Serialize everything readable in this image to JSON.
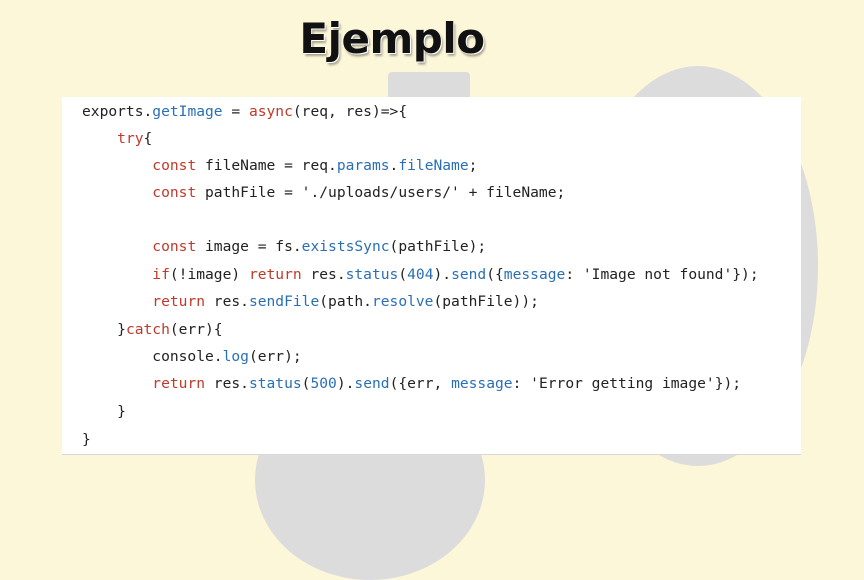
{
  "title": "Ejemplo",
  "code": {
    "lines": [
      [
        {
          "t": "exports.",
          "c": "plain"
        },
        {
          "t": "getImage",
          "c": "fn"
        },
        {
          "t": " = ",
          "c": "plain"
        },
        {
          "t": "async",
          "c": "kw"
        },
        {
          "t": "(req, res)=>{",
          "c": "plain"
        }
      ],
      [
        {
          "t": "    ",
          "c": "plain"
        },
        {
          "t": "try",
          "c": "kw"
        },
        {
          "t": "{",
          "c": "plain"
        }
      ],
      [
        {
          "t": "        ",
          "c": "plain"
        },
        {
          "t": "const",
          "c": "kw"
        },
        {
          "t": " fileName = req.",
          "c": "plain"
        },
        {
          "t": "params",
          "c": "prop"
        },
        {
          "t": ".",
          "c": "plain"
        },
        {
          "t": "fileName",
          "c": "prop"
        },
        {
          "t": ";",
          "c": "plain"
        }
      ],
      [
        {
          "t": "        ",
          "c": "plain"
        },
        {
          "t": "const",
          "c": "kw"
        },
        {
          "t": " pathFile = ",
          "c": "plain"
        },
        {
          "t": "'./uploads/users/'",
          "c": "str"
        },
        {
          "t": " + fileName;",
          "c": "plain"
        }
      ],
      [],
      [
        {
          "t": "        ",
          "c": "plain"
        },
        {
          "t": "const",
          "c": "kw"
        },
        {
          "t": " image = fs.",
          "c": "plain"
        },
        {
          "t": "existsSync",
          "c": "fn"
        },
        {
          "t": "(pathFile);",
          "c": "plain"
        }
      ],
      [
        {
          "t": "        ",
          "c": "plain"
        },
        {
          "t": "if",
          "c": "kw"
        },
        {
          "t": "(!image) ",
          "c": "plain"
        },
        {
          "t": "return",
          "c": "kw"
        },
        {
          "t": " res.",
          "c": "plain"
        },
        {
          "t": "status",
          "c": "fn"
        },
        {
          "t": "(",
          "c": "plain"
        },
        {
          "t": "404",
          "c": "num"
        },
        {
          "t": ").",
          "c": "plain"
        },
        {
          "t": "send",
          "c": "fn"
        },
        {
          "t": "({",
          "c": "plain"
        },
        {
          "t": "message",
          "c": "prop"
        },
        {
          "t": ": ",
          "c": "plain"
        },
        {
          "t": "'Image not found'",
          "c": "str"
        },
        {
          "t": "});",
          "c": "plain"
        }
      ],
      [
        {
          "t": "        ",
          "c": "plain"
        },
        {
          "t": "return",
          "c": "kw"
        },
        {
          "t": " res.",
          "c": "plain"
        },
        {
          "t": "sendFile",
          "c": "fn"
        },
        {
          "t": "(path.",
          "c": "plain"
        },
        {
          "t": "resolve",
          "c": "fn"
        },
        {
          "t": "(pathFile));",
          "c": "plain"
        }
      ],
      [
        {
          "t": "    }",
          "c": "plain"
        },
        {
          "t": "catch",
          "c": "kw"
        },
        {
          "t": "(err){",
          "c": "plain"
        }
      ],
      [
        {
          "t": "        console.",
          "c": "plain"
        },
        {
          "t": "log",
          "c": "fn"
        },
        {
          "t": "(err);",
          "c": "plain"
        }
      ],
      [
        {
          "t": "        ",
          "c": "plain"
        },
        {
          "t": "return",
          "c": "kw"
        },
        {
          "t": " res.",
          "c": "plain"
        },
        {
          "t": "status",
          "c": "fn"
        },
        {
          "t": "(",
          "c": "plain"
        },
        {
          "t": "500",
          "c": "num"
        },
        {
          "t": ").",
          "c": "plain"
        },
        {
          "t": "send",
          "c": "fn"
        },
        {
          "t": "({err, ",
          "c": "plain"
        },
        {
          "t": "message",
          "c": "prop"
        },
        {
          "t": ": ",
          "c": "plain"
        },
        {
          "t": "'Error getting image'",
          "c": "str"
        },
        {
          "t": "});",
          "c": "plain"
        }
      ],
      [
        {
          "t": "    }",
          "c": "plain"
        }
      ],
      [
        {
          "t": "}",
          "c": "plain"
        }
      ]
    ]
  }
}
